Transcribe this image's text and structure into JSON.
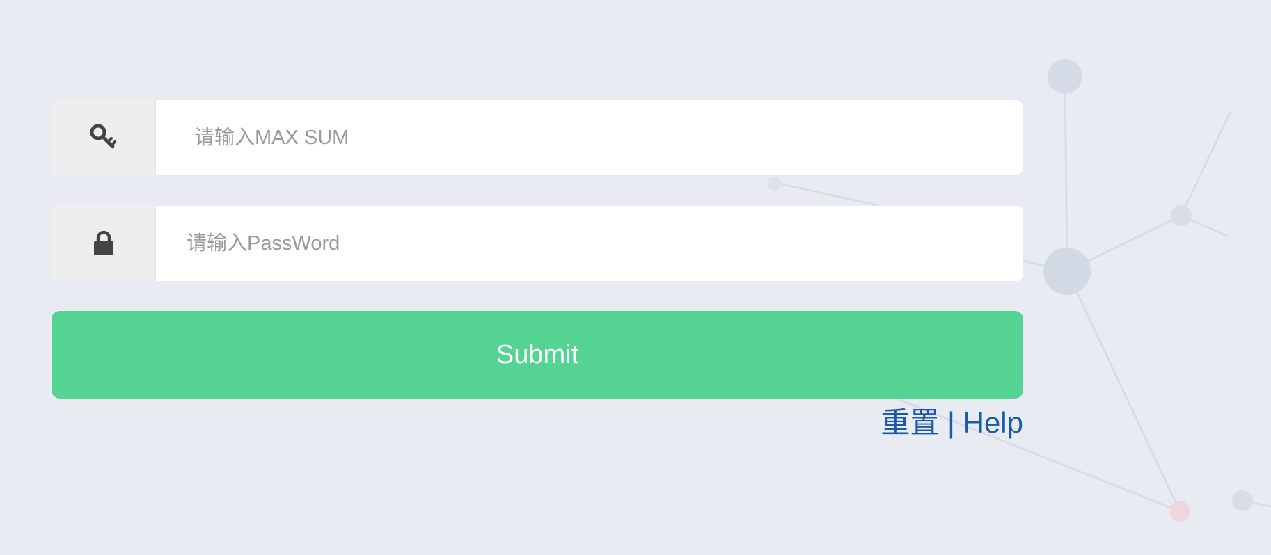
{
  "form": {
    "maxsum_field": {
      "icon": "key-icon",
      "placeholder": "请输入MAX SUM",
      "value": ""
    },
    "password_field": {
      "icon": "lock-icon",
      "placeholder": "请输入PassWord",
      "value": ""
    },
    "submit_label": "Submit"
  },
  "links": {
    "reset_label": "重置",
    "separator": "|",
    "help_label": "Help"
  },
  "colors": {
    "background": "#e8ebf2",
    "submit_button": "#55d392",
    "link": "#1a5aa8",
    "addon_background": "#eeeeee"
  }
}
